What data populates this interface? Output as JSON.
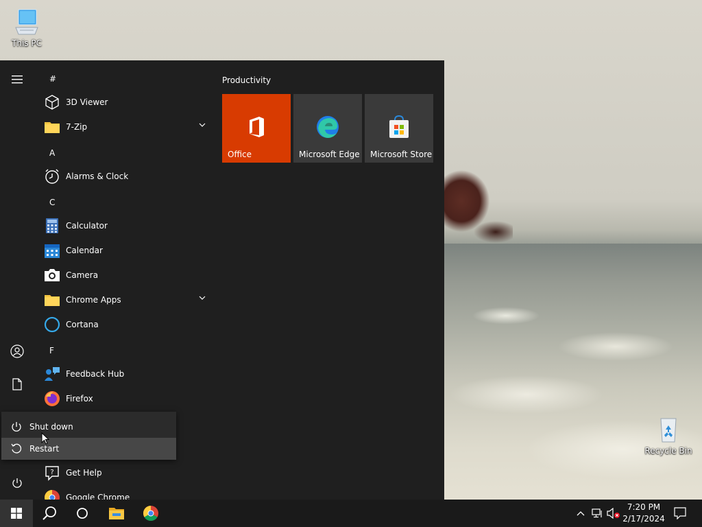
{
  "desktop": {
    "this_pc_label": "This PC",
    "recycle_bin_label": "Recycle Bin"
  },
  "start_menu": {
    "headers": [
      "#",
      "A",
      "C",
      "F"
    ],
    "apps": [
      {
        "name": "3D Viewer",
        "icon": "cube-icon"
      },
      {
        "name": "7-Zip",
        "icon": "folder-icon",
        "expandable": true
      },
      {
        "name": "Alarms & Clock",
        "icon": "clock-icon"
      },
      {
        "name": "Calculator",
        "icon": "calculator-icon"
      },
      {
        "name": "Calendar",
        "icon": "calendar-icon"
      },
      {
        "name": "Camera",
        "icon": "camera-icon"
      },
      {
        "name": "Chrome Apps",
        "icon": "folder-icon",
        "expandable": true
      },
      {
        "name": "Cortana",
        "icon": "cortana-icon"
      },
      {
        "name": "Feedback Hub",
        "icon": "feedback-icon"
      },
      {
        "name": "Firefox",
        "icon": "firefox-icon"
      },
      {
        "name": "Get Help",
        "icon": "help-icon"
      },
      {
        "name": "Google Chrome",
        "icon": "chrome-icon"
      }
    ],
    "tile_group": "Productivity",
    "tiles": [
      {
        "label": "Office",
        "color": "#d83b01"
      },
      {
        "label": "Microsoft Edge",
        "color": "#3a3a3a"
      },
      {
        "label": "Microsoft Store",
        "color": "#3a3a3a"
      }
    ],
    "power_menu": {
      "shutdown": "Shut down",
      "restart": "Restart"
    }
  },
  "taskbar": {
    "time": "7:20 PM",
    "date": "2/17/2024"
  }
}
